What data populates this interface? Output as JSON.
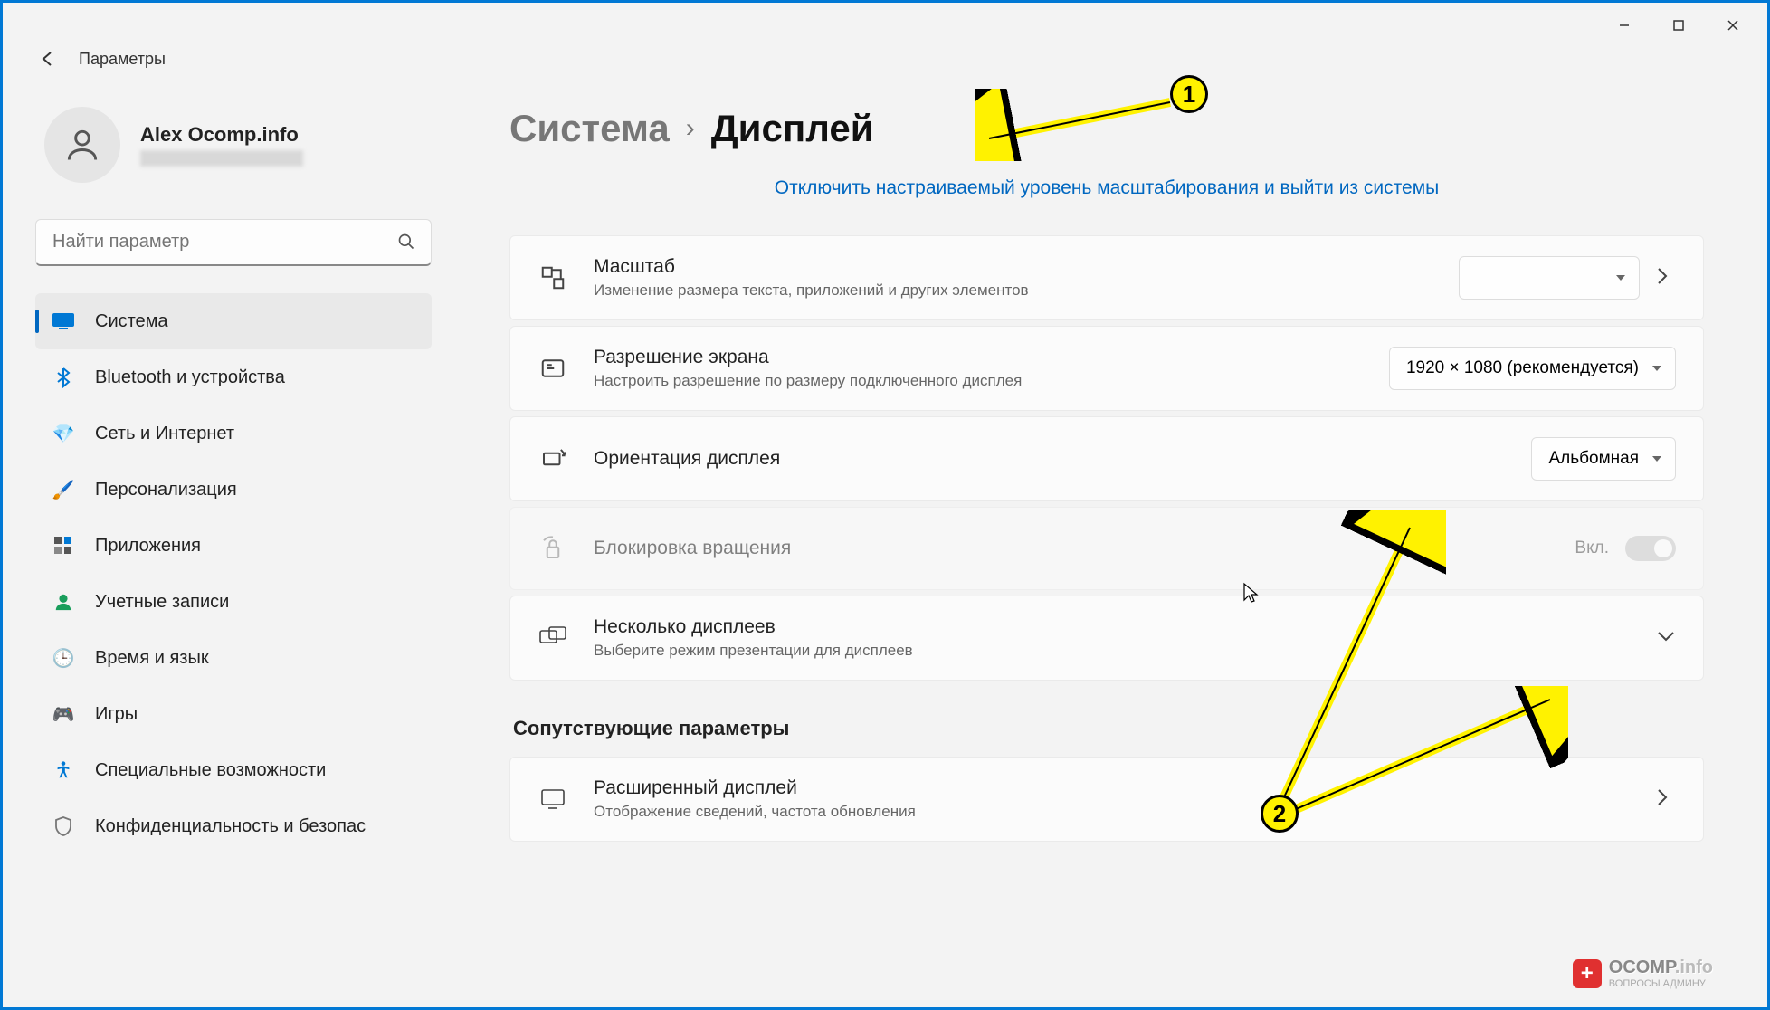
{
  "app_title": "Параметры",
  "profile": {
    "name": "Alex Ocomp.info"
  },
  "search": {
    "placeholder": "Найти параметр"
  },
  "nav": [
    {
      "label": "Система",
      "icon": "🖥️",
      "active": true
    },
    {
      "label": "Bluetooth и устройства",
      "icon": "bt"
    },
    {
      "label": "Сеть и Интернет",
      "icon": "🔷"
    },
    {
      "label": "Персонализация",
      "icon": "🖌️"
    },
    {
      "label": "Приложения",
      "icon": "▦"
    },
    {
      "label": "Учетные записи",
      "icon": "👤"
    },
    {
      "label": "Время и язык",
      "icon": "🌐"
    },
    {
      "label": "Игры",
      "icon": "🎮"
    },
    {
      "label": "Специальные возможности",
      "icon": "♿"
    },
    {
      "label": "Конфиденциальность и безопас",
      "icon": "🛡️"
    }
  ],
  "breadcrumb": {
    "parent": "Система",
    "current": "Дисплей"
  },
  "info_link": "Отключить настраиваемый уровень масштабирования и выйти из системы",
  "cards": {
    "scale": {
      "title": "Масштаб",
      "sub": "Изменение размера текста, приложений и других элементов"
    },
    "resolution": {
      "title": "Разрешение экрана",
      "sub": "Настроить разрешение по размеру подключенного дисплея",
      "value": "1920 × 1080 (рекомендуется)"
    },
    "orientation": {
      "title": "Ориентация дисплея",
      "value": "Альбомная"
    },
    "rotation_lock": {
      "title": "Блокировка вращения",
      "toggle_label": "Вкл."
    },
    "multi": {
      "title": "Несколько дисплеев",
      "sub": "Выберите режим презентации для дисплеев"
    },
    "advanced": {
      "title": "Расширенный дисплей",
      "sub": "Отображение сведений, частота обновления"
    }
  },
  "section_header": "Сопутствующие параметры",
  "annotations": {
    "badge1": "1",
    "badge2": "2"
  },
  "watermark": {
    "brand": "OCOMP",
    "tld": ".info",
    "sub": "ВОПРОСЫ АДМИНУ"
  }
}
